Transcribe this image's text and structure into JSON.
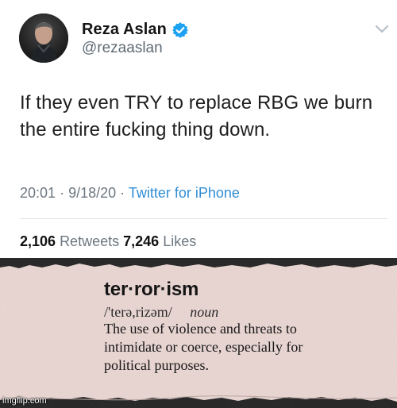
{
  "tweet": {
    "display_name": "Reza Aslan",
    "handle": "@rezaaslan",
    "text": "If they even TRY to replace RBG we burn the entire fucking thing down.",
    "time": "20:01",
    "date": "9/18/20",
    "source": "Twitter for iPhone",
    "retweets_count": "2,106",
    "retweets_label": "Retweets",
    "likes_count": "7,246",
    "likes_label": "Likes",
    "colors": {
      "link": "#2f8ed6",
      "verified": "#1da1f2"
    }
  },
  "dictionary": {
    "word": "ter·ror·ism",
    "pronunciation": "/'terə,rizəm/",
    "part_of_speech": "noun",
    "definition": "The use of violence and threats to intimidate or coerce, especially for political purposes."
  },
  "watermark": "imgflip.com",
  "icons": {
    "verified": "verified-check-icon",
    "menu": "chevron-down-icon"
  }
}
